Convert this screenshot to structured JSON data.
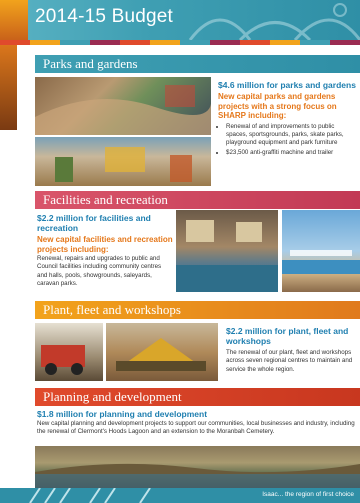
{
  "page": {
    "title": "2014-15 Budget"
  },
  "sections": {
    "parks": {
      "label": "Parks and gardens",
      "headline": "$4.6 million for parks and gardens",
      "subhead": "New capital parks and gardens projects with a strong focus on SHARP including:",
      "bullets": [
        "Renewal of and improvements to public spaces, sportsgrounds, parks, skate parks, playground equipment and park furniture",
        "$23,500 anti-graffiti machine and trailer"
      ]
    },
    "facilities": {
      "label": "Facilities and recreation",
      "headline": "$2.2 million for facilities and recreation",
      "subhead": "New capital facilities and recreation projects including:",
      "body": "Renewal, repairs and upgrades to public and Council facilities including community centres and halls, pools, showgrounds, saleyards, caravan parks."
    },
    "plant": {
      "label": "Plant, fleet and workshops",
      "headline": "$2.2 million for plant, fleet and workshops",
      "body": "The renewal of our plant, fleet and workshops across seven regional centres to maintain and service the whole region."
    },
    "planning": {
      "label": "Planning and development",
      "headline": "$1.8 million for planning and development",
      "body": "New capital planning and development projects to support our communities, local businesses and industry, including the renewal of Clermont's Hoods Lagoon and an extension to the Moranbah Cemetery."
    }
  },
  "footer": {
    "tagline": "Isaac... the region of first choice"
  },
  "colors": {
    "teal": "#3f9fb3",
    "orange": "#f2a31c",
    "red": "#e04a2c",
    "pink": "#d9556a",
    "blue_heading": "#1f7fb0",
    "orange_heading": "#e5781b"
  }
}
